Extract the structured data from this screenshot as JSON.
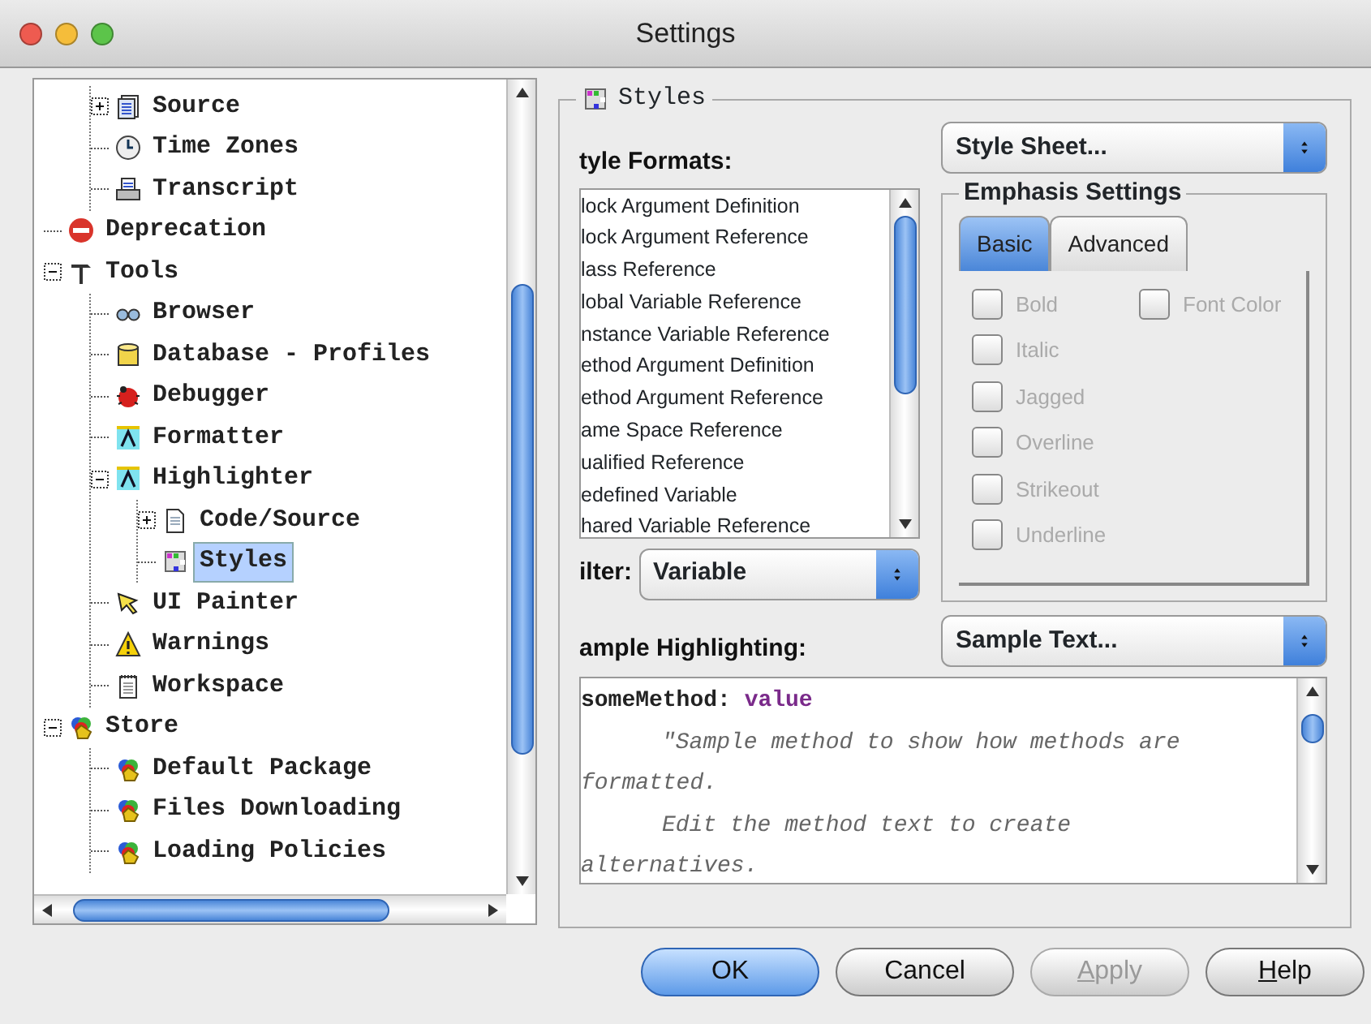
{
  "window": {
    "title": "Settings"
  },
  "tree": [
    {
      "children": [
        {
          "label": "Source",
          "kind": "source",
          "expanded": false,
          "selected": false
        },
        {
          "label": "Time Zones",
          "kind": "clock",
          "selected": false
        },
        {
          "label": "Transcript",
          "kind": "printer",
          "selected": false
        }
      ]
    },
    {
      "label": "Deprecation",
      "kind": "stop",
      "selected": false
    },
    {
      "label": "Tools",
      "kind": "hammer",
      "expanded": true,
      "selected": false,
      "children": [
        {
          "label": "Browser",
          "kind": "glasses",
          "selected": false
        },
        {
          "label": "Database - Profiles",
          "kind": "database",
          "selected": false
        },
        {
          "label": "Debugger",
          "kind": "bug",
          "selected": false
        },
        {
          "label": "Formatter",
          "kind": "formatter",
          "selected": false
        },
        {
          "label": "Highlighter",
          "kind": "formatter",
          "expanded": true,
          "selected": false,
          "children": [
            {
              "label": "Code/Source",
              "kind": "document",
              "expanded": false,
              "selected": false
            },
            {
              "label": "Styles",
              "kind": "styles",
              "selected": true
            }
          ]
        },
        {
          "label": "UI Painter",
          "kind": "pointer",
          "selected": false
        },
        {
          "label": "Warnings",
          "kind": "warning",
          "selected": false
        },
        {
          "label": "Workspace",
          "kind": "notepad",
          "selected": false
        }
      ]
    },
    {
      "label": "Store",
      "kind": "store",
      "expanded": true,
      "selected": false,
      "children": [
        {
          "label": "Default Package",
          "kind": "store",
          "selected": false
        },
        {
          "label": "Files Downloading",
          "kind": "store",
          "selected": false
        },
        {
          "label": "Loading Policies",
          "kind": "store",
          "selected": false
        }
      ]
    }
  ],
  "panel": {
    "title": "Styles",
    "style_formats_label": "tyle Formats:",
    "style_formats": [
      {
        "label": "lock Argument Definition",
        "selected": false
      },
      {
        "label": "lock Argument Reference",
        "selected": false
      },
      {
        "label": "lass Reference",
        "selected": false
      },
      {
        "label": "lobal Variable Reference",
        "selected": false
      },
      {
        "label": "nstance Variable Reference",
        "selected": false
      },
      {
        "label": "ethod Argument Definition",
        "selected": false
      },
      {
        "label": "ethod Argument Reference",
        "selected": false
      },
      {
        "label": "ame Space Reference",
        "selected": false
      },
      {
        "label": "ualified Reference",
        "selected": false
      },
      {
        "label": "edefined Variable",
        "selected": false
      },
      {
        "label": "hared Variable Reference",
        "selected": false
      }
    ],
    "filter": {
      "label": "ilter:",
      "value": "Variable"
    },
    "style_sheet": {
      "value": "Style Sheet..."
    },
    "emphasis": {
      "title": "Emphasis Settings",
      "tabs": [
        {
          "label": "Basic",
          "selected": true
        },
        {
          "label": "Advanced",
          "selected": false
        }
      ],
      "option_rows": [
        [
          {
            "label": "Bold",
            "checked": false,
            "disabled": true
          },
          {
            "label": "Font Color",
            "checked": false,
            "disabled": true
          }
        ],
        [
          {
            "label": "Italic",
            "checked": false,
            "disabled": true
          }
        ],
        [
          {
            "label": "Jagged",
            "checked": false,
            "disabled": true
          }
        ],
        [
          {
            "label": "Overline",
            "checked": false,
            "disabled": true
          }
        ],
        [
          {
            "label": "Strikeout",
            "checked": false,
            "disabled": true
          }
        ],
        [
          {
            "label": "Underline",
            "checked": false,
            "disabled": true
          }
        ]
      ]
    },
    "sample_label": "ample Highlighting:",
    "sample_select": {
      "value": "Sample Text..."
    },
    "code_lines": [
      {
        "indented": false,
        "parts": [
          {
            "text": "someMethod:",
            "kind": "selector"
          },
          {
            "text": " value",
            "kind": "argument"
          }
        ]
      },
      {
        "indented": true,
        "parts": [
          {
            "text": "\"Sample method to show how methods are",
            "kind": "comment"
          }
        ]
      },
      {
        "indented": false,
        "parts": [
          {
            "text": "formatted.",
            "kind": "comment"
          }
        ]
      },
      {
        "indented": true,
        "parts": [
          {
            "text": "Edit the method text to create",
            "kind": "comment"
          }
        ]
      },
      {
        "indented": false,
        "parts": [
          {
            "text": "alternatives.",
            "kind": "comment"
          }
        ]
      }
    ]
  },
  "buttons": [
    {
      "label": "OK",
      "default": true,
      "disabled": false,
      "mnemonic_first": false
    },
    {
      "label": "Cancel",
      "default": false,
      "disabled": false,
      "mnemonic_first": false
    },
    {
      "label": "Apply",
      "default": false,
      "disabled": true,
      "mnemonic_first": true
    },
    {
      "label": "Help",
      "default": false,
      "disabled": false,
      "mnemonic_first": true
    }
  ]
}
